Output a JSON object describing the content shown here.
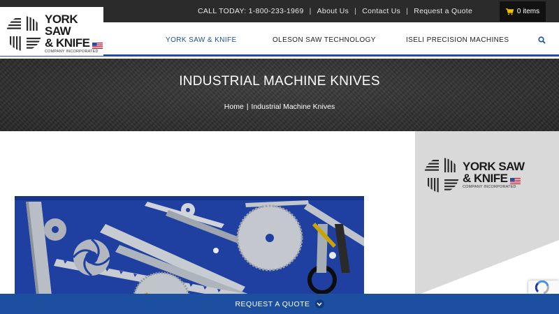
{
  "topbar": {
    "call_label": "CALL TODAY: 1-800-233-1969",
    "about_label": "About Us",
    "contact_label": "Contact Us",
    "quote_label": "Request a Quote",
    "separator": "|",
    "cart_label": "0 items",
    "cart_icon": "shopping-cart-icon"
  },
  "logo": {
    "line1": "YORK SAW",
    "line2": "& KNIFE",
    "sub": "COMPANY INCORPORATED"
  },
  "nav": {
    "items": [
      {
        "label": "YORK SAW & KNIFE",
        "active": true
      },
      {
        "label": "OLESON SAW TECHNOLOGY",
        "active": false
      },
      {
        "label": "ISELI PRECISION MACHINES",
        "active": false
      }
    ],
    "search_icon": "search-icon"
  },
  "hero": {
    "title": "INDUSTRIAL MACHINE KNIVES",
    "breadcrumb": {
      "home": "Home",
      "separator": "|",
      "current": "Industrial Machine Knives"
    }
  },
  "sidebar": {
    "logo": {
      "line1": "YORK SAW",
      "line2": "& KNIFE",
      "sub": "COMPANY INCORPORATED"
    }
  },
  "cta": {
    "label": "REQUEST A QUOTE",
    "icon": "chevron-down-icon"
  },
  "colors": {
    "brand_blue": "#1d4fa1",
    "topbar_bg": "#2b2b2b",
    "hero_bg": "#2f2f2f",
    "sidebar_bg": "#d9d9d9",
    "photo_bg": "#1e3f9a"
  }
}
